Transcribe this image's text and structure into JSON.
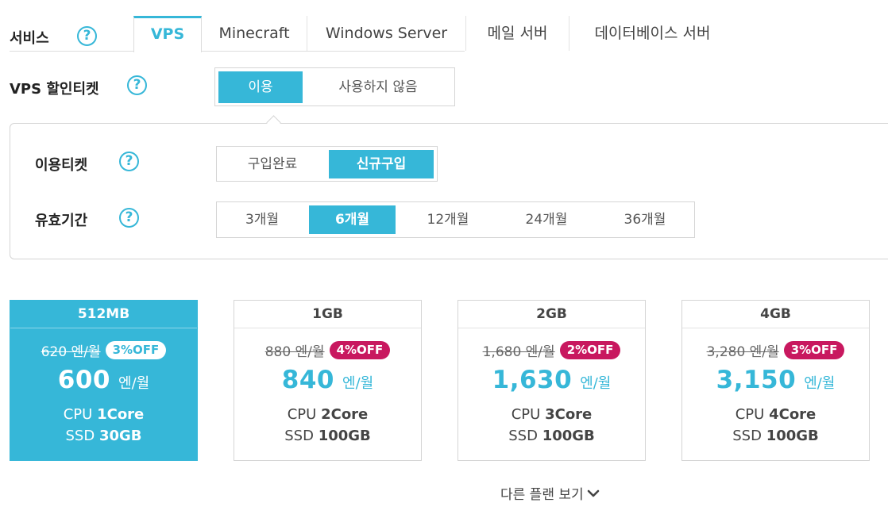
{
  "service": {
    "label": "서비스",
    "help_icon": "?",
    "tabs": [
      "VPS",
      "Minecraft",
      "Windows Server",
      "메일 서버",
      "데이터베이스 서버"
    ],
    "active_tab": "VPS"
  },
  "discount_ticket": {
    "label": "VPS 할인티켓",
    "options": [
      "이용",
      "사용하지 않음"
    ],
    "selected": "이용"
  },
  "use_ticket": {
    "label": "이용티켓",
    "options": [
      "구입완료",
      "신규구입"
    ],
    "selected": "신규구입"
  },
  "validity": {
    "label": "유효기간",
    "options": [
      "3개월",
      "6개월",
      "12개월",
      "24개월",
      "36개월"
    ],
    "selected": "6개월"
  },
  "plans": [
    {
      "name": "512MB",
      "old_price": "620 엔/월",
      "discount": "3%OFF",
      "price": "600",
      "unit": "엔/월",
      "cpu_label": "CPU",
      "cpu": "1Core",
      "ssd_label": "SSD",
      "ssd": "30GB",
      "selected": true
    },
    {
      "name": "1GB",
      "old_price": "880 엔/월",
      "discount": "4%OFF",
      "price": "840",
      "unit": "엔/월",
      "cpu_label": "CPU",
      "cpu": "2Core",
      "ssd_label": "SSD",
      "ssd": "100GB",
      "selected": false
    },
    {
      "name": "2GB",
      "old_price": "1,680 엔/월",
      "discount": "2%OFF",
      "price": "1,630",
      "unit": "엔/월",
      "cpu_label": "CPU",
      "cpu": "3Core",
      "ssd_label": "SSD",
      "ssd": "100GB",
      "selected": false
    },
    {
      "name": "4GB",
      "old_price": "3,280 엔/월",
      "discount": "3%OFF",
      "price": "3,150",
      "unit": "엔/월",
      "cpu_label": "CPU",
      "cpu": "4Core",
      "ssd_label": "SSD",
      "ssd": "100GB",
      "selected": false
    }
  ],
  "more_plans": {
    "label": "다른 플랜 보기",
    "icon": "chevron-down-icon"
  },
  "colors": {
    "accent": "#36b7d8",
    "badge": "#c8185f"
  }
}
